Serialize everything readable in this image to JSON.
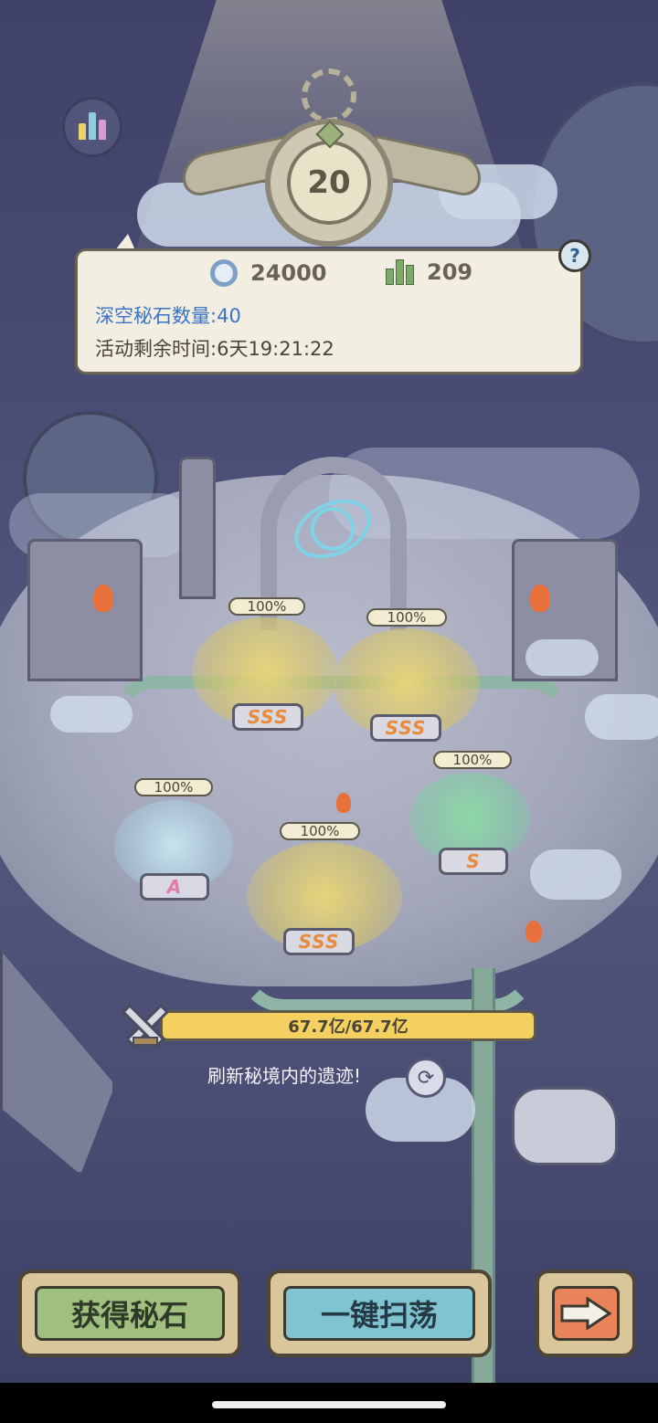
{
  "header": {
    "level": "20"
  },
  "info_panel": {
    "currency_amount": "24000",
    "score_amount": "209",
    "stone_label": "深空秘石数量:",
    "stone_count": "40",
    "time_label": "活动剩余时间:",
    "time_remaining": "6天19:21:22",
    "help_label": "?"
  },
  "ruins": [
    {
      "progress": "100%",
      "rank": "SSS"
    },
    {
      "progress": "100%",
      "rank": "SSS"
    },
    {
      "progress": "100%",
      "rank": "A"
    },
    {
      "progress": "100%",
      "rank": "SSS"
    },
    {
      "progress": "100%",
      "rank": "S"
    }
  ],
  "power": {
    "value": "67.7亿/67.7亿",
    "fill_fraction": 1.0
  },
  "refresh": {
    "text": "刷新秘境内的遗迹!"
  },
  "buttons": {
    "get_stone": "获得秘石",
    "sweep": "一键扫荡"
  },
  "icons": {
    "stats": "stats-bars-icon",
    "currency": "swirl-coin-icon",
    "score": "bar-chart-icon",
    "help": "question-icon",
    "swords": "crossed-swords-icon",
    "refresh": "refresh-icon",
    "next": "arrow-right-icon"
  },
  "colors": {
    "panel_bg": "#f2efe2",
    "stone_text": "#3b73c9",
    "power_bar": "#f4d060",
    "get_stone_btn": "#9fc07f",
    "sweep_btn": "#7fc4d0",
    "next_btn": "#e9845a"
  }
}
